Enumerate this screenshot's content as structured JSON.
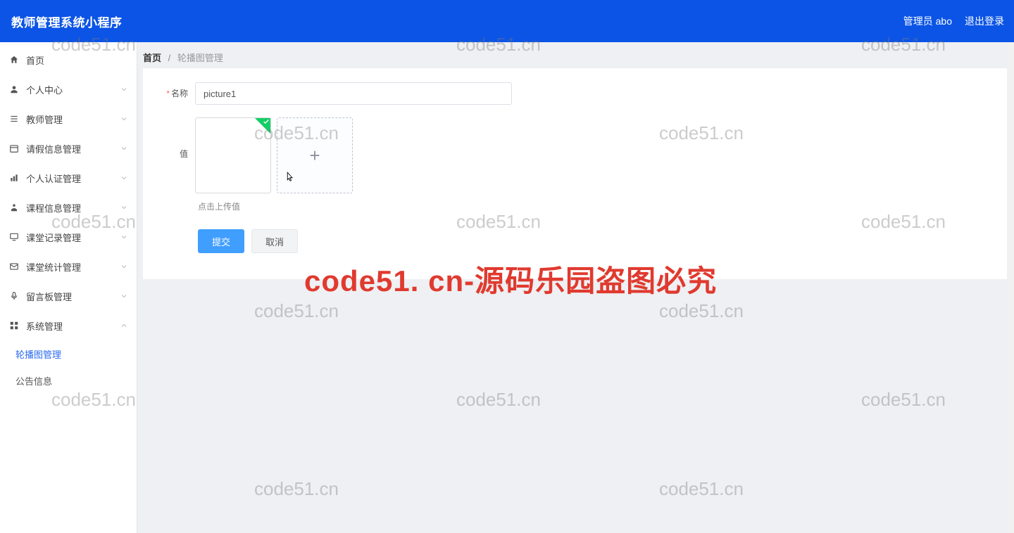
{
  "header": {
    "title": "教师管理系统小程序",
    "admin_label": "管理员 abo",
    "logout_label": "退出登录"
  },
  "sidebar": {
    "items": [
      {
        "icon": "home-icon",
        "label": "首页",
        "arrow": false
      },
      {
        "icon": "user-icon",
        "label": "个人中心",
        "arrow": true
      },
      {
        "icon": "list-icon",
        "label": "教师管理",
        "arrow": true
      },
      {
        "icon": "calendar-icon",
        "label": "请假信息管理",
        "arrow": true
      },
      {
        "icon": "chart-icon",
        "label": "个人认证管理",
        "arrow": true
      },
      {
        "icon": "doc-icon",
        "label": "课程信息管理",
        "arrow": true
      },
      {
        "icon": "monitor-icon",
        "label": "课堂记录管理",
        "arrow": true
      },
      {
        "icon": "mail-icon",
        "label": "课堂统计管理",
        "arrow": true
      },
      {
        "icon": "mic-icon",
        "label": "留言板管理",
        "arrow": true
      },
      {
        "icon": "grid-icon",
        "label": "系统管理",
        "arrow": true,
        "expanded": true
      }
    ],
    "sub_items": [
      {
        "label": "轮播图管理",
        "active": true
      },
      {
        "label": "公告信息",
        "active": false
      }
    ]
  },
  "breadcrumb": {
    "home": "首页",
    "current": "轮播图管理"
  },
  "form": {
    "name_label": "名称",
    "name_value": "picture1",
    "value_label": "值",
    "upload_tip": "点击上传值",
    "submit_label": "提交",
    "cancel_label": "取消"
  },
  "watermark": {
    "small": "code51.cn",
    "big": "code51. cn-源码乐园盗图必究"
  }
}
